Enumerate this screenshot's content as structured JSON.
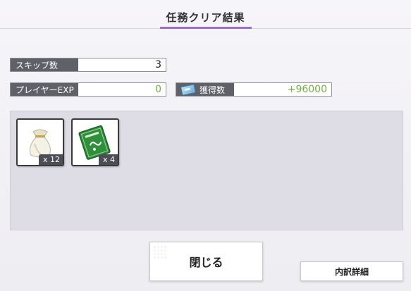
{
  "header": {
    "title": "任務クリア結果"
  },
  "stats": {
    "skip": {
      "label": "スキップ数",
      "value": "3"
    },
    "exp": {
      "label": "プレイヤーEXP",
      "value": "0"
    },
    "gain": {
      "label": "獲得数",
      "value": "+96000",
      "icon": "ticket-icon"
    }
  },
  "rewards": [
    {
      "name": "pouch-item",
      "count": "x 12"
    },
    {
      "name": "green-book-item",
      "count": "x 4"
    }
  ],
  "buttons": {
    "close": "閉じる",
    "detail": "内訳詳細"
  },
  "colors": {
    "accent": "#9b6bd6",
    "gain_text": "#6fb33a",
    "label_bg": "#5f6068"
  }
}
